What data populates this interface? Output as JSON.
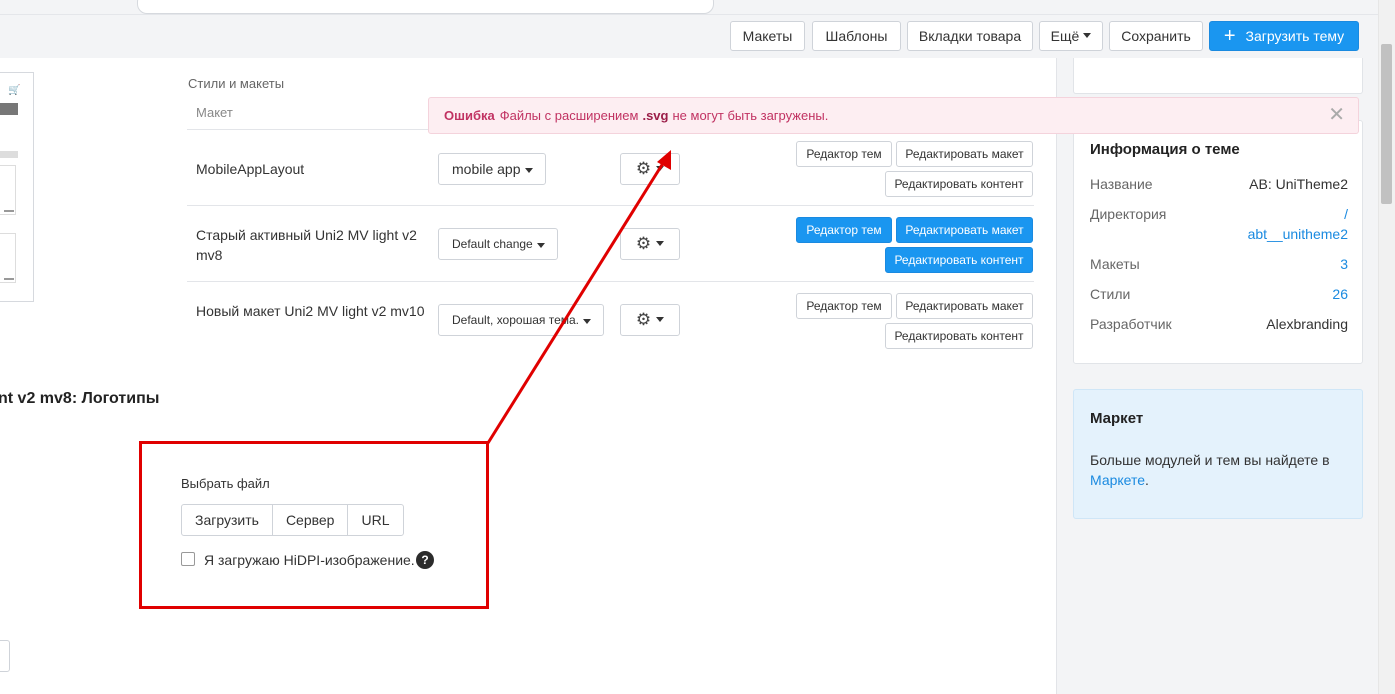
{
  "toolbar": {
    "layouts": "Макеты",
    "templates": "Шаблоны",
    "product_tabs": "Вкладки товара",
    "more": "Ещё",
    "save": "Сохранить",
    "upload_theme": "Загрузить тему"
  },
  "styles_section": {
    "title": "Стили и макеты",
    "column_header": "Макет",
    "rows": [
      {
        "name": "MobileAppLayout",
        "style": "mobile app",
        "theme_editor": "Редактор тем",
        "edit_layout": "Редактировать макет",
        "edit_content": "Редактировать контент",
        "active": false
      },
      {
        "name": "Старый активный Uni2 MV light v2 mv8",
        "style": "Default change",
        "theme_editor": "Редактор тем",
        "edit_layout": "Редактировать макет",
        "edit_content": "Редактировать контент",
        "active": true
      },
      {
        "name": "Новый макет Uni2 MV light v2 mv10",
        "style": "Default, хорошая тема.",
        "theme_editor": "Редактор тем",
        "edit_layout": "Редактировать макет",
        "edit_content": "Редактировать контент",
        "active": false
      }
    ]
  },
  "error": {
    "label": "Ошибка",
    "text_before": "Файлы с расширением",
    "extension": ".svg",
    "text_after": "не могут быть загружены."
  },
  "logos": {
    "heading": "nt v2 mv8: Логотипы",
    "choose_file": "Выбрать файл",
    "sources": [
      "Загрузить",
      "Сервер",
      "URL"
    ],
    "hidpi_label": "Я загружаю HiDPI-изображение.",
    "hidpi_checked": false
  },
  "theme_info": {
    "title": "Информация о теме",
    "rows": [
      {
        "key": "Название",
        "value": "AB: UniTheme2"
      },
      {
        "key": "Директория",
        "value_line1": "/",
        "value_line2": "abt__unitheme2"
      },
      {
        "key": "Макеты",
        "value": "3"
      },
      {
        "key": "Стили",
        "value": "26"
      },
      {
        "key": "Разработчик",
        "value": "Alexbranding"
      }
    ]
  },
  "market": {
    "title": "Маркет",
    "text": "Больше модулей и тем вы найдете в",
    "link": "Маркете"
  },
  "colors": {
    "primary": "#1a96f0",
    "annotation": "#e00000",
    "error_bg": "#fdeef2",
    "error_text": "#c13262"
  }
}
